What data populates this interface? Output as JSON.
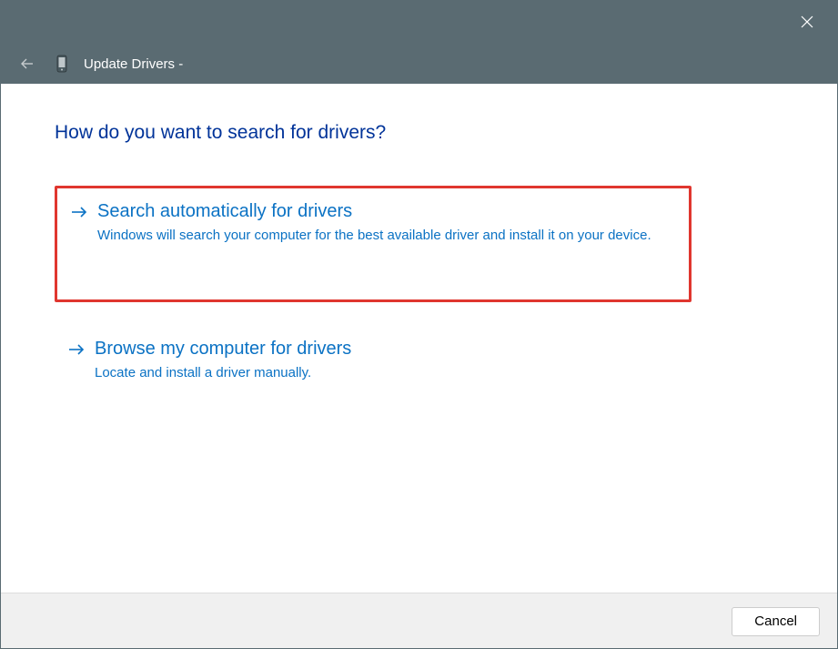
{
  "titlebar": {
    "window_title": "Update Drivers -"
  },
  "heading": "How do you want to search for drivers?",
  "options": [
    {
      "title": "Search automatically for drivers",
      "desc": "Windows will search your computer for the best available driver and install it on your device."
    },
    {
      "title": "Browse my computer for drivers",
      "desc": "Locate and install a driver manually."
    }
  ],
  "footer": {
    "cancel_label": "Cancel"
  }
}
